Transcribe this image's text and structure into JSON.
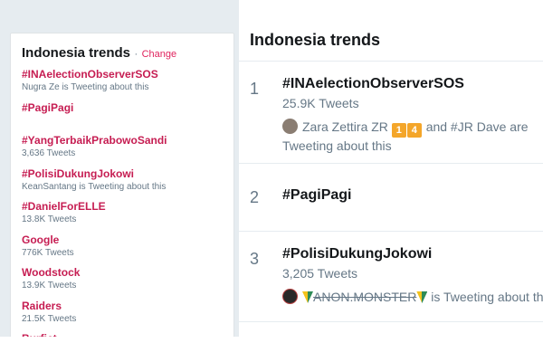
{
  "sidebar": {
    "title": "Indonesia trends",
    "separator": "·",
    "change_label": "Change",
    "items": [
      {
        "name": "#INAelectionObserverSOS",
        "sub": "Nugra Ze is Tweeting about this"
      },
      {
        "name": "#PagiPagi",
        "sub": ""
      },
      {
        "name": "#YangTerbaikPrabowoSandi",
        "sub": "3,636 Tweets"
      },
      {
        "name": "#PolisiDukungJokowi",
        "sub": "KeanSantang is Tweeting about this"
      },
      {
        "name": "#DanielForELLE",
        "sub": "13.8K Tweets"
      },
      {
        "name": "Google",
        "sub": "776K Tweets"
      },
      {
        "name": "Woodstock",
        "sub": "13.9K Tweets"
      },
      {
        "name": "Raiders",
        "sub": "21.5K Tweets"
      },
      {
        "name": "Burfict",
        "sub": ""
      }
    ]
  },
  "main": {
    "title": "Indonesia trends",
    "trends": [
      {
        "rank": "1",
        "name": "#INAelectionObserverSOS",
        "count": "25.9K Tweets",
        "context": {
          "user": "Zara Zettira ZR",
          "emoji_1": "1",
          "emoji_2": "4",
          "and_text": "and #JR Dave are",
          "tail": "Tweeting about this"
        }
      },
      {
        "rank": "2",
        "name": "#PagiPagi"
      },
      {
        "rank": "3",
        "name": "#PolisiDukungJokowi",
        "count": "3,205 Tweets",
        "context": {
          "user": "ANON.MONSTER",
          "tail": "is Tweeting about this"
        }
      }
    ]
  },
  "colors": {
    "trend_accent": "#c61d52",
    "muted_text": "#657786",
    "background": "#e6ecf0"
  },
  "icons": {
    "avatar_1": "user-avatar-icon",
    "avatar_2": "user-avatar-icon",
    "emoji": "keycap-emoji-icon",
    "badge": "leaf-badge-icon"
  }
}
